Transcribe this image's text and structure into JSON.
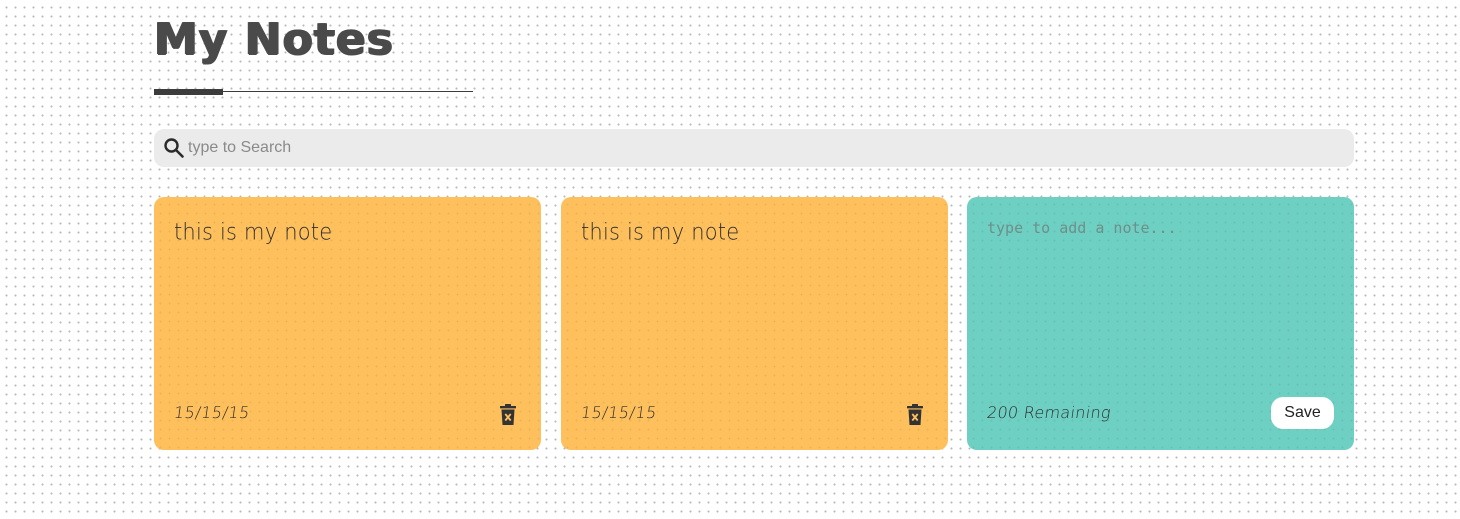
{
  "header": {
    "title": "My Notes"
  },
  "search": {
    "placeholder": "type to Search",
    "value": ""
  },
  "notes": [
    {
      "text": "this is my note",
      "date": "15/15/15",
      "icon": "trash-x-icon"
    },
    {
      "text": "this is my note",
      "date": "15/15/15",
      "icon": "trash-x-icon"
    }
  ],
  "new_note": {
    "placeholder": "type to add a note...",
    "remaining_text": "200 Remaining",
    "save_label": "Save"
  },
  "colors": {
    "note_background": "#fec05d",
    "new_note_background": "#6ecfc3",
    "search_background": "#ebebeb",
    "title_color": "#4a4a4a"
  }
}
